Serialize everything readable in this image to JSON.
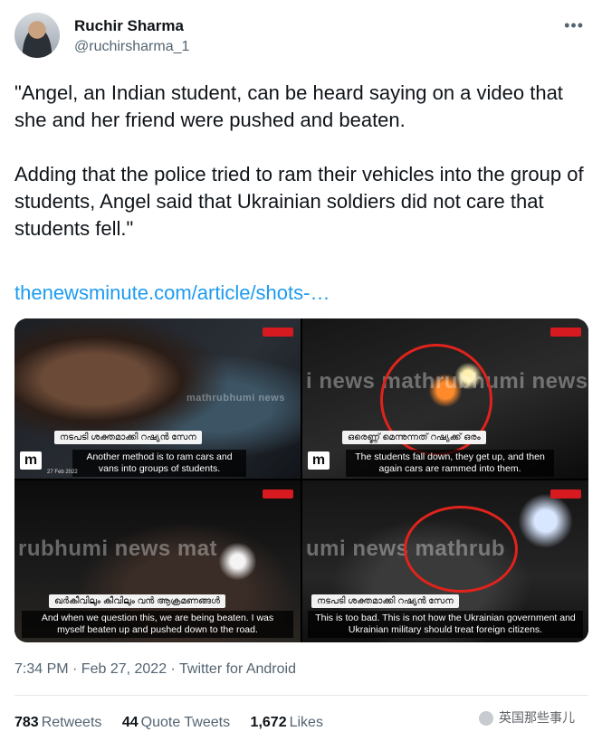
{
  "author": {
    "name": "Ruchir Sharma",
    "handle": "@ruchirsharma_1",
    "more_icon": "more-horizontal-icon"
  },
  "tweet": {
    "text": "\"Angel, an Indian student, can be heard saying on a video that she and her friend were pushed and beaten.\n\nAdding that the police tried to ram their vehicles into the group of students, Angel said that Ukrainian soldiers did not care that students fell.\"",
    "link": "thenewsminute.com/article/shots-…"
  },
  "media": [
    {
      "watermark": "mathrubhumi news",
      "label": "നടപടി ശക്തമാക്കി റഷ്യൻ സേന",
      "caption": "Another method is to ram cars and vans into groups of students.",
      "date": "27 Feb 2022",
      "logo": "m"
    },
    {
      "watermark": "i news   mathrubhumi news",
      "label": "ഒരെണ്ണ് മെന്നുന്നത് റഷ്യക്ക് ഒരം",
      "caption": "The students fall down, they get up, and then again cars are rammed into them.",
      "logo": "m"
    },
    {
      "watermark": "rubhumi news   mat",
      "label": "ഖർകീവിലും കീവിലും വൻ ആക്രമണങ്ങൾ",
      "caption": "And when we question this, we are being beaten. I was myself beaten up and pushed down to the road."
    },
    {
      "watermark": "umi news   mathrub",
      "label": "നടപടി ശക്തമാക്കി റഷ്യൻ സേന",
      "caption": "This is too bad. This is not how the Ukrainian government and Ukrainian military should treat foreign citizens."
    }
  ],
  "meta": {
    "time": "7:34 PM · Feb 27, 2022 · Twitter for Android"
  },
  "stats": {
    "retweets_count": "783",
    "retweets_label": "Retweets",
    "quotes_count": "44",
    "quotes_label": "Quote Tweets",
    "likes_count": "1,672",
    "likes_label": "Likes"
  },
  "watermark_overlay": {
    "text": "英国那些事儿"
  }
}
